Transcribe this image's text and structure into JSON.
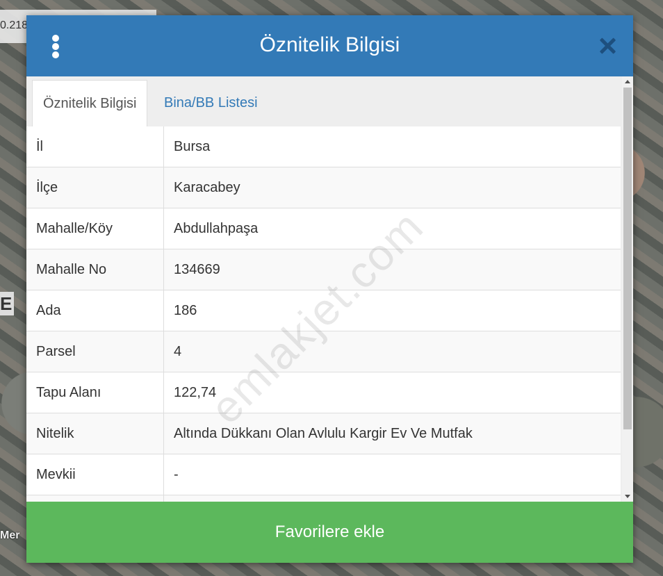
{
  "map": {
    "coord_text": "0.218",
    "side_letter": "E",
    "bottom_label": "Mer"
  },
  "dialog": {
    "title": "Öznitelik Bilgisi",
    "menu_icon": "kebab-vertical-icon",
    "close_icon": "close-icon",
    "tabs": [
      {
        "label": "Öznitelik Bilgisi",
        "active": true
      },
      {
        "label": "Bina/BB Listesi",
        "active": false
      }
    ],
    "rows": [
      {
        "label": "İl",
        "value": "Bursa"
      },
      {
        "label": "İlçe",
        "value": "Karacabey"
      },
      {
        "label": "Mahalle/Köy",
        "value": "Abdullahpaşa"
      },
      {
        "label": "Mahalle No",
        "value": "134669"
      },
      {
        "label": "Ada",
        "value": "186"
      },
      {
        "label": "Parsel",
        "value": "4"
      },
      {
        "label": "Tapu Alanı",
        "value": "122,74"
      },
      {
        "label": "Nitelik",
        "value": "Altında Dükkanı Olan Avlulu Kargir Ev Ve Mutfak"
      },
      {
        "label": "Mevkii",
        "value": "-"
      },
      {
        "label": "",
        "value": ""
      }
    ],
    "watermark": "emlakjet.com",
    "favorite_button_label": "Favorilere ekle"
  },
  "colors": {
    "header": "#337ab7",
    "favorite_button": "#5cb85c",
    "tab_link": "#337ab7"
  }
}
